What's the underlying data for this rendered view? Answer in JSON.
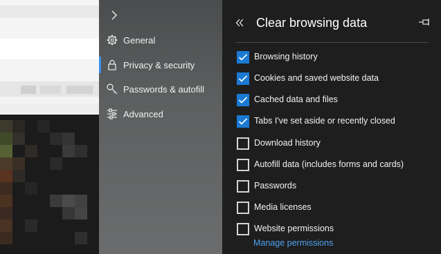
{
  "nav": {
    "items": [
      {
        "label": "General",
        "icon": "gear-icon"
      },
      {
        "label": "Privacy & security",
        "icon": "lock-icon",
        "selected": true
      },
      {
        "label": "Passwords & autofill",
        "icon": "key-icon"
      },
      {
        "label": "Advanced",
        "icon": "sliders-icon"
      }
    ],
    "accent_color": "#3b8ee8"
  },
  "panel": {
    "title": "Clear browsing data",
    "options": [
      {
        "label": "Browsing history",
        "checked": true
      },
      {
        "label": "Cookies and saved website data",
        "checked": true
      },
      {
        "label": "Cached data and files",
        "checked": true
      },
      {
        "label": "Tabs I've set aside or recently closed",
        "checked": true
      },
      {
        "label": "Download history",
        "checked": false
      },
      {
        "label": "Autofill data (includes forms and cards)",
        "checked": false
      },
      {
        "label": "Passwords",
        "checked": false
      },
      {
        "label": "Media licenses",
        "checked": false
      },
      {
        "label": "Website permissions",
        "checked": false
      }
    ],
    "manage_link": "Manage permissions",
    "checkbox_color": "#1a7ad4",
    "link_color": "#4ea1f0"
  }
}
